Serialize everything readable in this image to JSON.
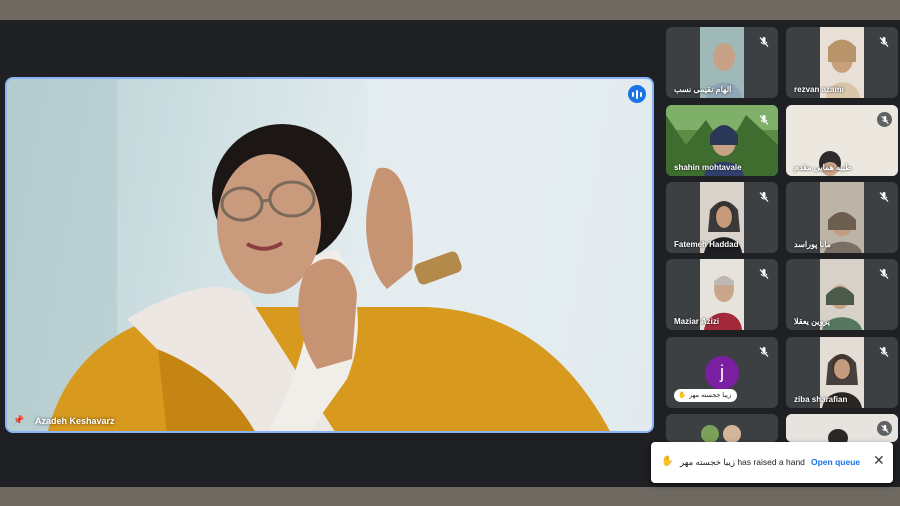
{
  "main": {
    "presenter_name": "Azadeh Keshavarz"
  },
  "participants": [
    {
      "name": "الهام تقیمی نسب",
      "muted": true
    },
    {
      "name": "rezvan azami",
      "muted": true
    },
    {
      "name": "shahin mohtavale",
      "muted": true
    },
    {
      "name": "طیبه همایی مقدم",
      "muted": true
    },
    {
      "name": "Fatemeh Haddad",
      "muted": true
    },
    {
      "name": "مانا پوراسد",
      "muted": true
    },
    {
      "name": "Maziar Azizi",
      "muted": true
    },
    {
      "name": "پروین یعقلا",
      "muted": true
    },
    {
      "name": "زیبا خجسته مهر",
      "avatar_letter": "j",
      "hand_raised": true,
      "muted": true
    },
    {
      "name": "ziba sharafian",
      "muted": true
    }
  ],
  "toast": {
    "message": "زیبا خجسته مهر has raised a hand",
    "action_label": "Open queue",
    "close_icon": "✕"
  },
  "colors": {
    "accent": "#1a73e8",
    "tile_bg": "#3c4043",
    "avatar_j": "#7b1fa2"
  }
}
